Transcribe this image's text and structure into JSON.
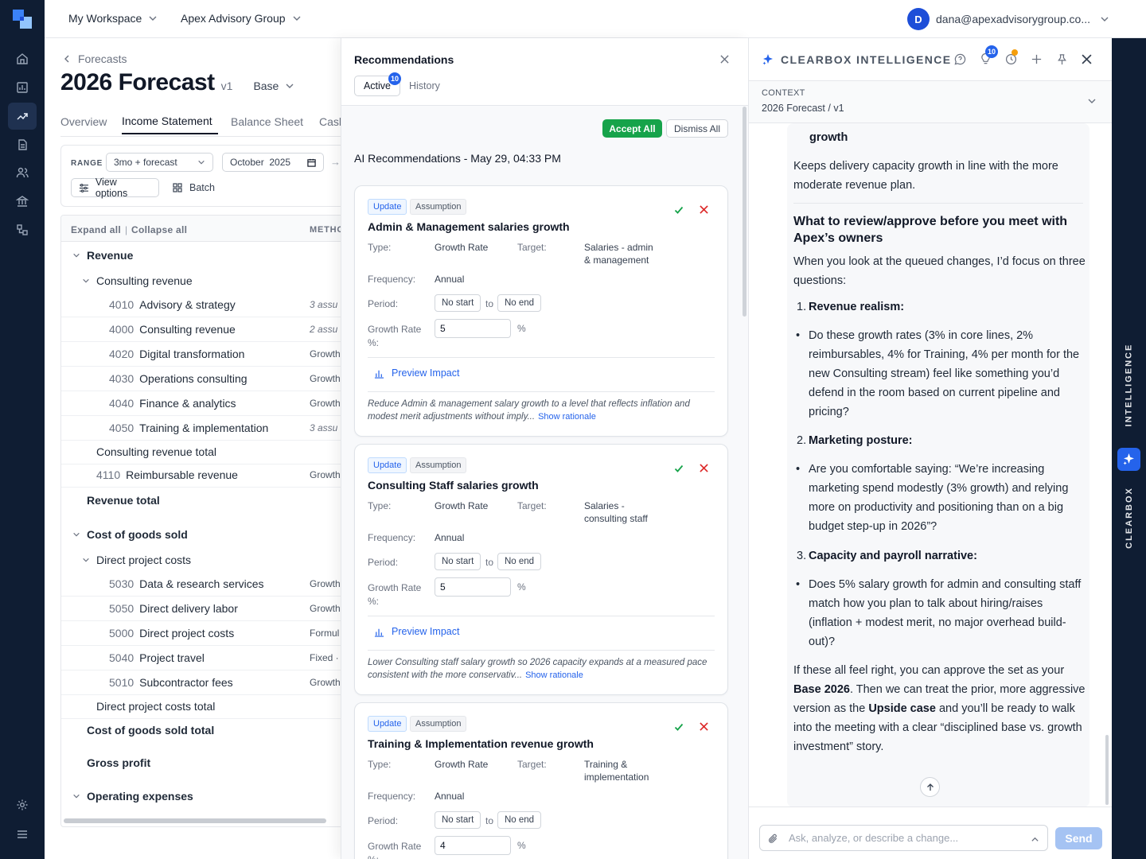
{
  "topbar": {
    "workspace": "My Workspace",
    "company": "Apex Advisory Group",
    "avatar_initial": "D",
    "user_email": "dana@apexadvisorygroup.co..."
  },
  "page": {
    "breadcrumb": "Forecasts",
    "title": "2026 Forecast",
    "version": "v1",
    "scenario": "Base",
    "tabs": [
      "Overview",
      "Income Statement",
      "Balance Sheet",
      "Cash"
    ],
    "active_tab": "Income Statement"
  },
  "toolbar": {
    "range_label": "RANGE",
    "range_value": "3mo + forecast",
    "date_value": "October  2025",
    "view_options": "View options",
    "batch": "Batch"
  },
  "table": {
    "expand_all": "Expand all",
    "sep": "|",
    "collapse_all": "Collapse all",
    "method_header": "METHO",
    "rows": [
      {
        "label": "Revenue"
      },
      {
        "label": "Consulting revenue"
      },
      {
        "code": "4010",
        "label": "Advisory & strategy",
        "method": "3 assu"
      },
      {
        "code": "4000",
        "label": "Consulting revenue",
        "method": "2 assu"
      },
      {
        "code": "4020",
        "label": "Digital transformation",
        "method": "Growth"
      },
      {
        "code": "4030",
        "label": "Operations consulting",
        "method": "Growth"
      },
      {
        "code": "4040",
        "label": "Finance & analytics",
        "method": "Growth"
      },
      {
        "code": "4050",
        "label": "Training & implementation",
        "method": "3 assu"
      },
      {
        "label": "Consulting revenue total"
      },
      {
        "code": "4110",
        "label": "Reimbursable revenue",
        "method": "Growth"
      },
      {
        "label": "Revenue total"
      },
      {
        "label": "Cost of goods sold"
      },
      {
        "label": "Direct project costs"
      },
      {
        "code": "5030",
        "label": "Data & research services",
        "method": "Growth"
      },
      {
        "code": "5050",
        "label": "Direct delivery labor",
        "method": "Growth"
      },
      {
        "code": "5000",
        "label": "Direct project costs",
        "method": "Formul"
      },
      {
        "code": "5040",
        "label": "Project travel",
        "method": "Fixed ·"
      },
      {
        "code": "5010",
        "label": "Subcontractor fees",
        "method": "Growth"
      },
      {
        "label": "Direct project costs total"
      },
      {
        "label": "Cost of goods sold total"
      },
      {
        "label": "Gross profit"
      },
      {
        "label": "Operating expenses"
      }
    ]
  },
  "recs": {
    "title": "Recommendations",
    "tab_active": "Active",
    "tab_active_count": "10",
    "tab_history": "History",
    "accept_all": "Accept All",
    "dismiss_all": "Dismiss All",
    "heading": "AI Recommendations - May 29, 04:33 PM",
    "labels": {
      "type": "Type:",
      "target": "Target:",
      "frequency": "Frequency:",
      "period": "Period:",
      "growth_rate_1": "Growth Rate",
      "growth_rate_2": "%:",
      "to": "to",
      "pct": "%",
      "preview": "Preview Impact",
      "show_rationale": "Show rationale"
    },
    "cards": [
      {
        "tag1": "Update",
        "tag2": "Assumption",
        "title": "Admin & Management salaries growth",
        "type": "Growth Rate",
        "target_1": "Salaries - admin",
        "target_2": "& management",
        "frequency": "Annual",
        "period_start": "No start",
        "period_end": "No end",
        "rate": "5",
        "rationale": "Reduce Admin & management salary growth to a level that reflects inflation and modest merit adjustments without imply..."
      },
      {
        "tag1": "Update",
        "tag2": "Assumption",
        "title": "Consulting Staff salaries growth",
        "type": "Growth Rate",
        "target_1": "Salaries -",
        "target_2": "consulting staff",
        "frequency": "Annual",
        "period_start": "No start",
        "period_end": "No end",
        "rate": "5",
        "rationale": "Lower Consulting staff salary growth so 2026 capacity expands at a measured pace consistent with the more conservativ..."
      },
      {
        "tag1": "Update",
        "tag2": "Assumption",
        "title": "Training & Implementation revenue growth",
        "type": "Growth Rate",
        "target_1": "Training &",
        "target_2": "implementation",
        "frequency": "Annual",
        "period_start": "No start",
        "period_end": "No end",
        "rate": "4",
        "rationale": ""
      }
    ]
  },
  "chat": {
    "brand": "CLEARBOX INTELLIGENCE",
    "badge_count": "10",
    "context_label": "CONTEXT",
    "context_value": "2026 Forecast / v1",
    "msg": {
      "growth_tail": "growth",
      "p1": "Keeps delivery capacity growth in line with the more moderate revenue plan.",
      "h": "What to review/approve before you meet with Apex’s owners",
      "p2": "When you look at the queued changes, I’d focus on three questions:",
      "n1": "1.",
      "n1_title": "Revenue realism:",
      "b1": "Do these growth rates (3% in core lines, 2% reimbursables, 4% for Training, 4% per month for the new Consulting stream) feel like something you’d defend in the room based on current pipeline and pricing?",
      "n2": "2.",
      "n2_title": "Marketing posture:",
      "b2": "Are you comfortable saying: “We’re increasing marketing spend modestly (3% growth) and relying more on productivity and positioning than on a big budget step-up in 2026”?",
      "n3": "3.",
      "n3_title": "Capacity and payroll narrative:",
      "b3": "Does 5% salary growth for admin and consulting staff match how you plan to talk about hiring/raises (inflation + modest merit, no major overhead build-out)?",
      "p3a": "If these all feel right, you can approve the set as your ",
      "p3b": "Base 2026",
      "p3c": ". Then we can treat the prior, more aggressive version as the ",
      "p3d": "Upside case",
      "p3e": " and you’ll be ready to walk into the meeting with a clear “disciplined base vs. growth investment” story."
    },
    "input_placeholder": "Ask, analyze, or describe a change...",
    "send": "Send"
  },
  "strip": {
    "text_top": "INTELLIGENCE",
    "text_bottom": "CLEARBOX"
  },
  "colors": {
    "rail": "#0f1d33",
    "accent_blue": "#2563eb",
    "accept_green": "#16a34a",
    "reject_red": "#dc2626"
  }
}
